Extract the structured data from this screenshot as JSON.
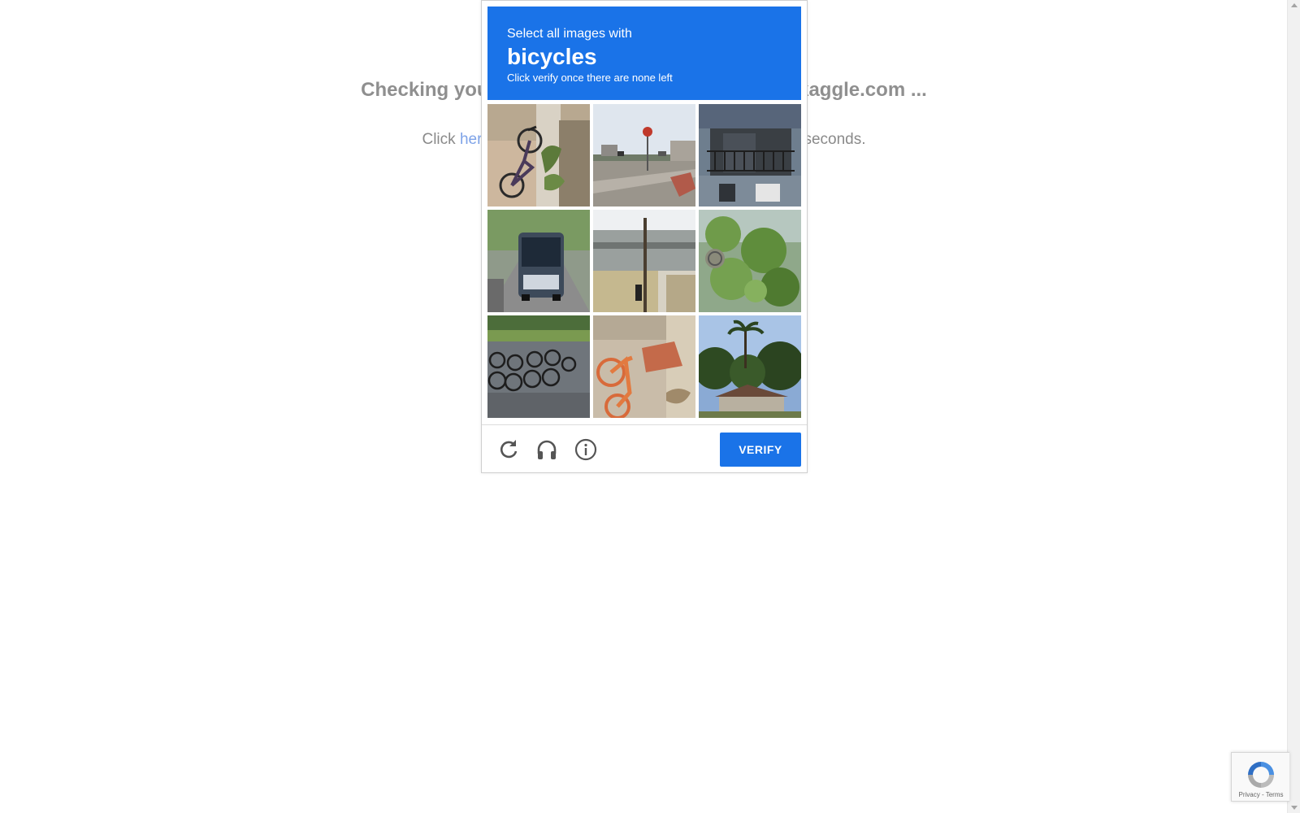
{
  "background": {
    "heading": "Checking your browser before accessing www.kaggle.com ...",
    "text_before": "Click ",
    "link_text": "here",
    "text_after": " if you are not automatically redirected after 5 seconds."
  },
  "captcha": {
    "instruction": "Select all images with",
    "keyword": "bicycles",
    "sub_instruction": "Click verify once there are none left",
    "tiles": [
      {
        "index": 1,
        "label": "bicycle leaning on post"
      },
      {
        "index": 2,
        "label": "street with stop sign"
      },
      {
        "index": 3,
        "label": "house balcony"
      },
      {
        "index": 4,
        "label": "bus on road"
      },
      {
        "index": 5,
        "label": "building with pole"
      },
      {
        "index": 6,
        "label": "trees and foliage"
      },
      {
        "index": 7,
        "label": "parked bicycles"
      },
      {
        "index": 8,
        "label": "orange bicycle"
      },
      {
        "index": 9,
        "label": "palm tree and house"
      }
    ],
    "footer": {
      "reload_icon": "reload-icon",
      "audio_icon": "headphones-icon",
      "info_icon": "info-icon",
      "verify_label": "VERIFY"
    },
    "colors": {
      "accent": "#1a73e8"
    }
  },
  "badge": {
    "privacy": "Privacy",
    "separator": " - ",
    "terms": "Terms"
  }
}
